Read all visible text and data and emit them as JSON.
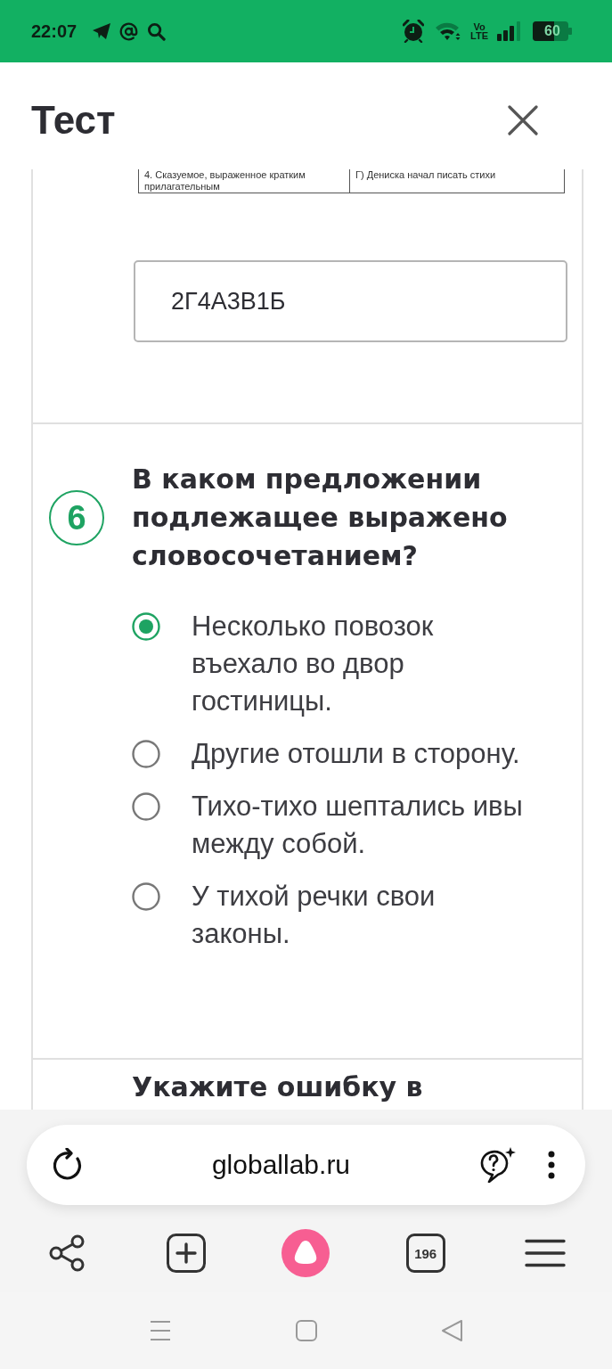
{
  "status_bar": {
    "time": "22:07",
    "network_label": [
      "Vo",
      "LTE"
    ],
    "battery": "60"
  },
  "header": {
    "title": "Тест"
  },
  "previous_question": {
    "table_rows": [
      [
        "4. Сказуемое, выраженное кратким прилагательным",
        "Г) Дениска начал писать стихи"
      ]
    ],
    "answer": "2Г4А3В1Б"
  },
  "question": {
    "number": "6",
    "text": "В каком предложении подлежащее выражено словосочетанием?",
    "options": [
      {
        "label": "Несколько повозок въехало во двор гостиницы.",
        "selected": true
      },
      {
        "label": "Другие отошли в сторону.",
        "selected": false
      },
      {
        "label": "Тихо-тихо шептались ивы между собой.",
        "selected": false
      },
      {
        "label": "У тихой речки свои законы.",
        "selected": false
      }
    ]
  },
  "next_question": {
    "text": "Укажите ошибку в"
  },
  "browser": {
    "url": "globallab.ru",
    "tab_count": "196"
  }
}
